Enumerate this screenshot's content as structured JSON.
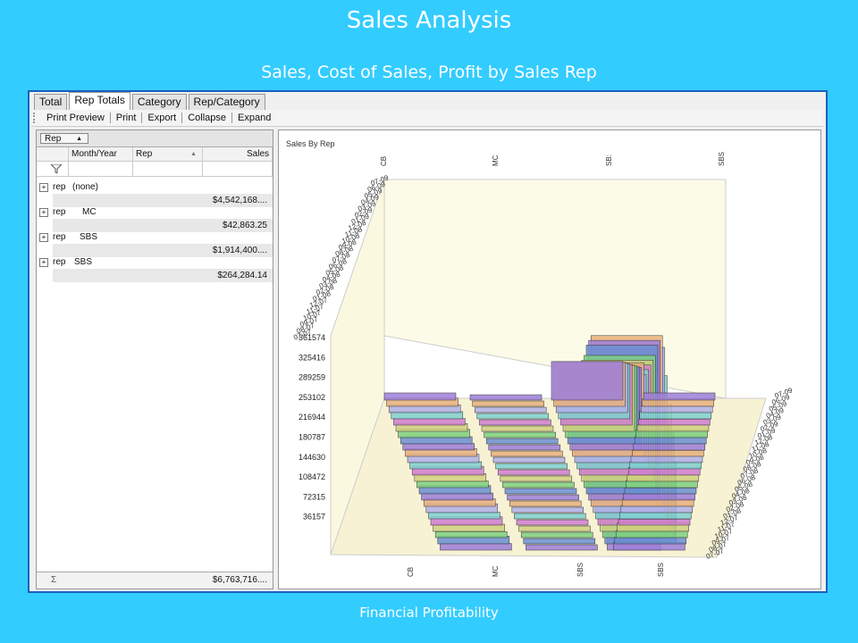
{
  "slide": {
    "title": "Sales Analysis",
    "subtitle": "Sales, Cost of Sales, Profit by Sales Rep",
    "footer": "Financial Profitability"
  },
  "tabs": [
    "Total",
    "Rep Totals",
    "Category",
    "Rep/Category"
  ],
  "active_tab": "Rep Totals",
  "toolbar": {
    "print_preview": "Print Preview",
    "print": "Print",
    "export": "Export",
    "collapse": "Collapse",
    "expand": "Expand"
  },
  "grid": {
    "group_chip": "Rep",
    "columns": [
      "Month/Year",
      "Rep",
      "Sales"
    ],
    "groups": [
      {
        "label": "rep",
        "name": "(none)",
        "subtotal": "$4,542,168...."
      },
      {
        "label": "rep",
        "name": "MC",
        "subtotal": "$42,863.25"
      },
      {
        "label": "rep",
        "name": "SBS",
        "subtotal": "$1,914,400...."
      },
      {
        "label": "rep",
        "name": "SBS",
        "subtotal": "$264,284.14"
      }
    ],
    "sum_symbol": "Σ",
    "grand_total": "$6,763,716...."
  },
  "chart_data": {
    "type": "bar",
    "title": "Sales By Rep",
    "categories": [
      "CB",
      "MC",
      "SBS",
      "SBS"
    ],
    "top_categories": [
      "CB",
      "MC",
      "SB:",
      "SBS"
    ],
    "months": [
      "07-07",
      "08-07",
      "09-07",
      "10-07",
      "11-07",
      "12-07",
      "01-08",
      "02-08",
      "03-08",
      "04-08",
      "05-08",
      "06-08",
      "07-08",
      "08-08",
      "09-08",
      "10-08",
      "11-08",
      "12-08",
      "01-09",
      "02-09",
      "03-09",
      "04-09",
      "05-09",
      "06-09",
      "07-09"
    ],
    "y_ticks": [
      "36157",
      "72315",
      "108472",
      "144630",
      "180787",
      "216944",
      "253102",
      "289259",
      "325416",
      "361574"
    ],
    "ylim": [
      0,
      361574
    ],
    "series_colors": [
      "#9d7fd8",
      "#6b8fd0",
      "#7fd07f",
      "#d0d07f",
      "#d07fd0",
      "#7fd0d0",
      "#b0b0e8",
      "#e8b07f"
    ],
    "grid": true,
    "values": {
      "CB": [
        12000,
        14000,
        11000,
        13000,
        15000,
        12000,
        16000,
        14000,
        13000,
        15000,
        12000,
        14000,
        16000,
        13000,
        15000,
        14000,
        12000,
        13000,
        15000,
        14000,
        12000,
        13000,
        14000,
        15000,
        13000
      ],
      "MC": [
        2000,
        1800,
        1600,
        1900,
        1700,
        1500,
        1800,
        1600,
        1700,
        1900,
        1800,
        1600,
        1700,
        1800,
        1900,
        1700,
        1600,
        1800,
        1700,
        1600,
        1800,
        1700,
        1900,
        1600,
        1700
      ],
      "SBS1": [
        361574,
        150000,
        190000,
        230000,
        180000,
        260000,
        300000,
        310000,
        290000,
        270000,
        240000,
        220000,
        200000,
        180000,
        160000,
        170000,
        150000,
        140000,
        130000,
        120000,
        110000,
        100000,
        90000,
        80000,
        70000
      ],
      "SBS2": [
        14000,
        12000,
        13000,
        15000,
        11000,
        12000,
        13000,
        14000,
        12000,
        11000,
        13000,
        12000,
        14000,
        13000,
        12000,
        11000,
        12000,
        13000,
        14000,
        12000,
        11000,
        13000,
        12000,
        14000,
        13000
      ]
    }
  }
}
